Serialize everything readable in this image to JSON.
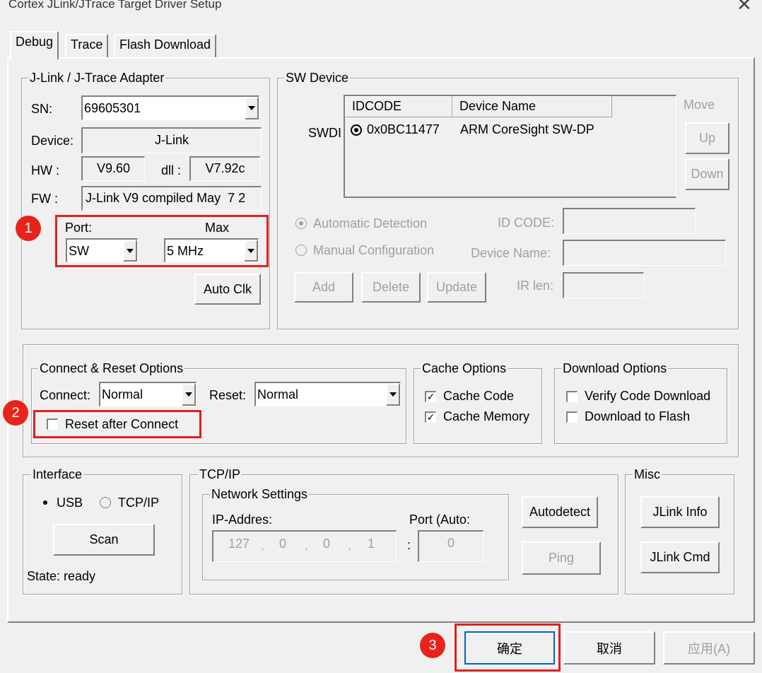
{
  "window": {
    "title": "Cortex JLink/JTrace Target Driver Setup",
    "close_glyph": "✕"
  },
  "tabs": [
    "Debug",
    "Trace",
    "Flash Download"
  ],
  "adapter": {
    "group": "J-Link / J-Trace Adapter",
    "sn_label": "SN:",
    "sn_value": "69605301",
    "device_label": "Device:",
    "device_value": "J-Link",
    "hw_label": "HW :",
    "hw_value": "V9.60",
    "dll_label": "dll :",
    "dll_value": "V7.92c",
    "fw_label": "FW :",
    "fw_value": "J-Link V9 compiled May  7 2",
    "port_label": "Port:",
    "port_value": "SW",
    "max_label": "Max",
    "max_value": "5 MHz",
    "auto_clk": "Auto Clk"
  },
  "sw_device": {
    "group": "SW Device",
    "swdi_label": "SWDI",
    "columns": [
      "IDCODE",
      "Device Name"
    ],
    "rows": [
      {
        "idcode": "0x0BC11477",
        "name": "ARM CoreSight SW-DP"
      }
    ],
    "move_label": "Move",
    "up": "Up",
    "down": "Down",
    "auto_detect": "Automatic Detection",
    "manual_config": "Manual Configuration",
    "id_code_label": "ID CODE:",
    "device_name_label": "Device Name:",
    "ir_len_label": "IR len:",
    "add": "Add",
    "delete": "Delete",
    "update": "Update"
  },
  "connect_reset": {
    "group": "Connect & Reset Options",
    "connect_label": "Connect:",
    "connect_value": "Normal",
    "reset_label": "Reset:",
    "reset_value": "Normal",
    "reset_after_connect": "Reset after Connect",
    "reset_after_connect_checked": false
  },
  "cache": {
    "group": "Cache Options",
    "cache_code": "Cache Code",
    "cache_code_checked": true,
    "cache_memory": "Cache Memory",
    "cache_memory_checked": true
  },
  "download": {
    "group": "Download Options",
    "verify": "Verify Code Download",
    "verify_checked": false,
    "to_flash": "Download to Flash",
    "to_flash_checked": false
  },
  "interface": {
    "group": "Interface",
    "usb": "USB",
    "tcpip": "TCP/IP",
    "selected": "USB",
    "scan": "Scan",
    "state": "State: ready"
  },
  "tcpip": {
    "group": "TCP/IP",
    "network_group": "Network Settings",
    "ip_label": "IP-Addres:",
    "ip": [
      "127",
      "0",
      "0",
      "1"
    ],
    "port_label": "Port (Auto:",
    "port_value": "0",
    "autodetect": "Autodetect",
    "ping": "Ping"
  },
  "misc": {
    "group": "Misc",
    "jlink_info": "JLink Info",
    "jlink_cmd": "JLink Cmd"
  },
  "footer": {
    "ok": "确定",
    "cancel": "取消",
    "apply": "应用(A)"
  },
  "annotations": [
    "1",
    "2",
    "3"
  ],
  "colors": {
    "highlight": "#e02020",
    "badge": "#e8231b",
    "background": "#f0f0f0"
  }
}
